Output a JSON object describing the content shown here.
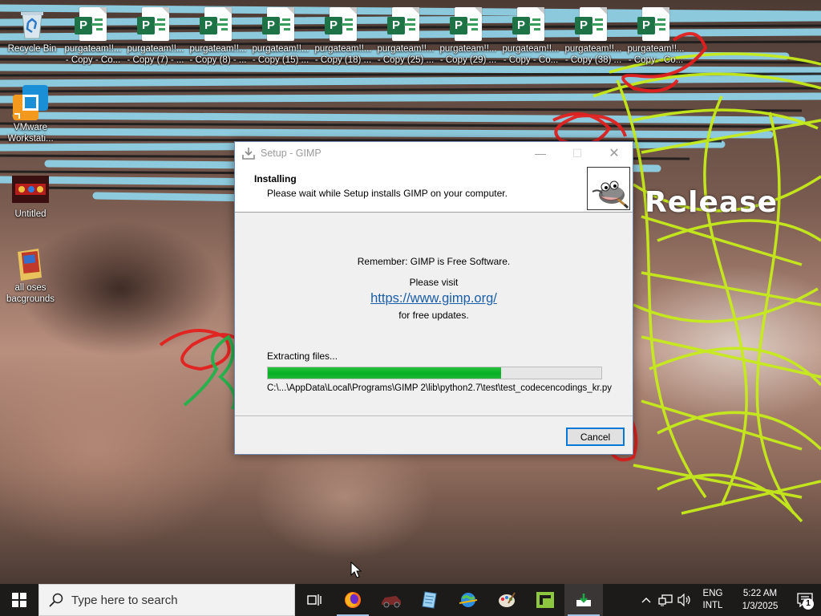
{
  "desktop": {
    "top_row_icons": [
      {
        "label": "Recycle Bin"
      },
      {
        "label": "purgateam!!...\n- Copy - Co..."
      },
      {
        "label": "purgateam!!...\n- Copy (7) - ..."
      },
      {
        "label": "purgateam!!...\n- Copy (8) - ..."
      },
      {
        "label": "purgateam!!...\n- Copy (15) ..."
      },
      {
        "label": "purgateam!!...\n- Copy (18) ..."
      },
      {
        "label": "purgateam!!...\n- Copy (25) ..."
      },
      {
        "label": "purgateam!!...\n- Copy (29) ..."
      },
      {
        "label": "purgateam!!...\n- Copy - Co..."
      },
      {
        "label": "purgateam!!...\n- Copy (38) ..."
      },
      {
        "label": "purgateam!!...\n- Copy - Co..."
      }
    ],
    "left_icons": [
      {
        "label": "VMware\nWorkstati..."
      },
      {
        "label": "Untitled"
      },
      {
        "label": "all oses\nbacgrounds"
      }
    ],
    "wallpaper_text": "Release"
  },
  "setup": {
    "window_title": "Setup - GIMP",
    "minimize": "—",
    "maximize": "☐",
    "close": "✕",
    "header_title": "Installing",
    "header_subtitle": "Please wait while Setup installs GIMP on your computer.",
    "remember": "Remember: GIMP is Free Software.",
    "please_visit": "Please visit",
    "link": "https://www.gimp.org/",
    "for_updates": "for free updates.",
    "status": "Extracting files...",
    "progress_percent": 70,
    "file_path": "C:\\...\\AppData\\Local\\Programs\\GIMP 2\\lib\\python2.7\\test\\test_codecencodings_kr.py",
    "cancel_label": "Cancel",
    "accent_color": "#06b025"
  },
  "taskbar": {
    "search_placeholder": "Type here to search",
    "apps": [
      "task-view-icon",
      "firefox-icon",
      "car-game-icon",
      "notepad-icon",
      "globe-download-icon",
      "paint-palette-icon",
      "green-app-icon",
      "setup-installer-icon"
    ],
    "language_line1": "ENG",
    "language_line2": "INTL",
    "time": "5:22 AM",
    "date": "1/3/2025",
    "notification_count": "1"
  }
}
